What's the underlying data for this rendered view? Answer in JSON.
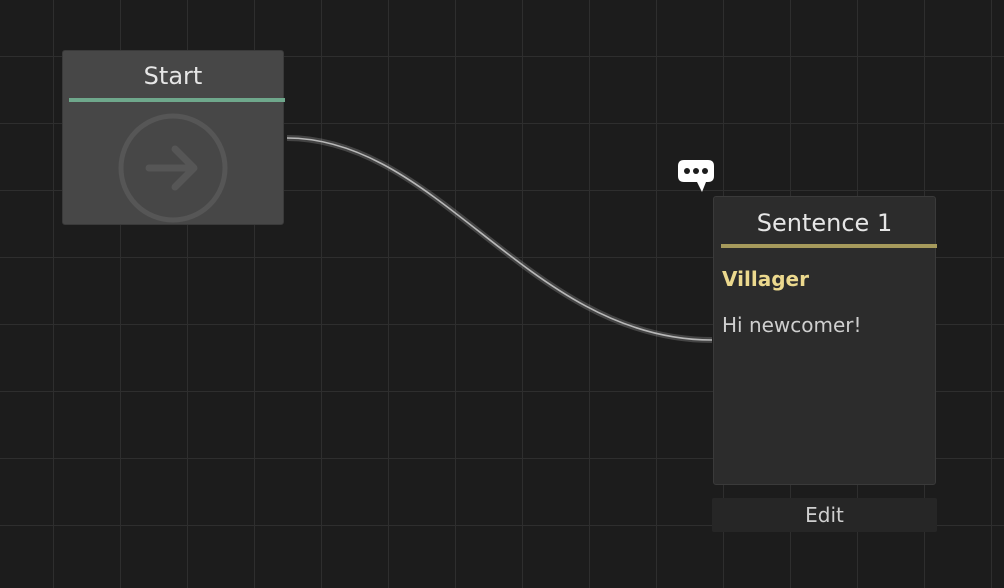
{
  "canvas": {
    "background_color": "#1c1c1c",
    "grid_color": "#2e2e2e"
  },
  "start_node": {
    "title": "Start",
    "accent_color": "#6fa88c",
    "icon": "arrow-right-circle-icon"
  },
  "sentence_node": {
    "title": "Sentence 1",
    "accent_color": "#a69a5c",
    "speaker": "Villager",
    "speaker_color": "#ecd98e",
    "text": "Hi newcomer!",
    "badge_icon": "speech-bubble-icon"
  },
  "edit_button": {
    "label": "Edit"
  },
  "connection": {
    "from": "Start",
    "to": "Sentence 1"
  }
}
